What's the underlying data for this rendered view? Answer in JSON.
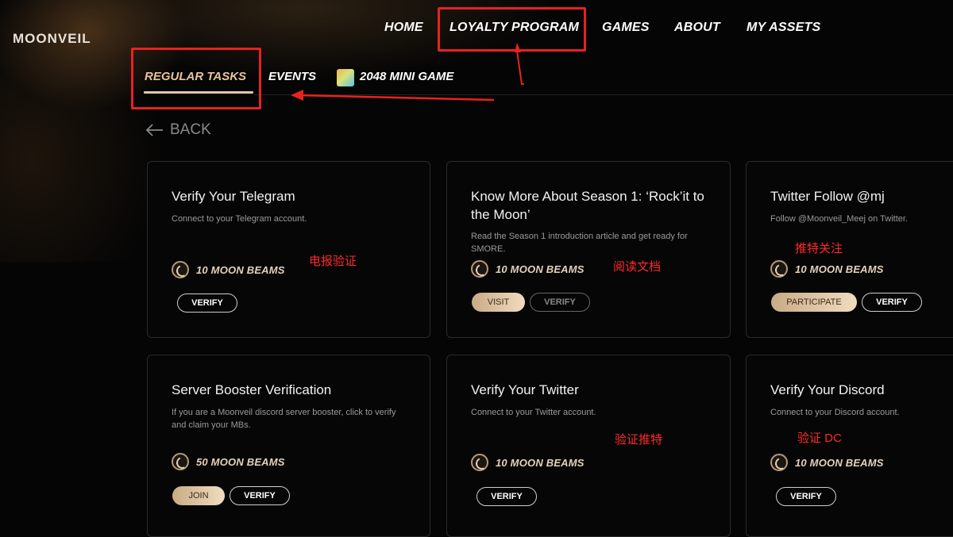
{
  "brand": {
    "name": "MOONVEIL"
  },
  "nav": {
    "home": "HOME",
    "loyalty": "LOYALTY PROGRAM",
    "games": "GAMES",
    "about": "ABOUT",
    "assets": "MY ASSETS"
  },
  "subnav": {
    "regular": "REGULAR TASKS",
    "events": "EVENTS",
    "minigame": "2048 MINI GAME"
  },
  "back_label": "BACK",
  "cards": [
    {
      "title": "Verify Your Telegram",
      "desc": "Connect to your Telegram account.",
      "reward": "10 MOON BEAMS",
      "note": "电报验证",
      "buttons": [
        "VERIFY"
      ]
    },
    {
      "title": "Know More About Season 1: ‘Rock’it to the Moon’",
      "desc": "Read the Season 1 introduction article and get ready for SMORE.",
      "reward": "10 MOON BEAMS",
      "note": "阅读文档",
      "buttons": [
        "VISIT",
        "VERIFY"
      ]
    },
    {
      "title": "Twitter Follow @mj",
      "desc": "Follow @Moonveil_Meej on Twitter.",
      "reward": "10 MOON BEAMS",
      "note": "推特关注",
      "buttons": [
        "PARTICIPATE",
        "VERIFY"
      ]
    },
    {
      "title": "Server Booster Verification",
      "desc": "If you are a Moonveil discord server booster, click to verify and claim your MBs.",
      "reward": "50 MOON BEAMS",
      "note": "",
      "buttons": [
        "JOIN",
        "VERIFY"
      ]
    },
    {
      "title": "Verify Your Twitter",
      "desc": "Connect to your Twitter account.",
      "reward": "10 MOON BEAMS",
      "note": "验证推特",
      "buttons": [
        "VERIFY"
      ]
    },
    {
      "title": "Verify Your Discord",
      "desc": "Connect to your Discord account.",
      "reward": "10 MOON BEAMS",
      "note": "验证 DC",
      "buttons": [
        "VERIFY"
      ]
    }
  ],
  "colors": {
    "accent": "#e9c497",
    "annotation": "#e8221d",
    "background": "#050505"
  }
}
